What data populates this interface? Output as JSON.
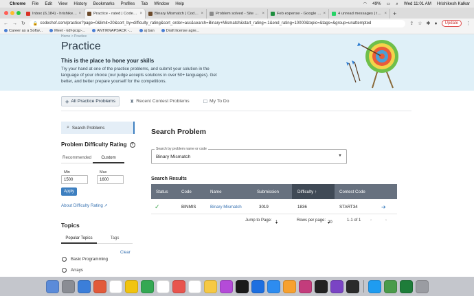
{
  "menubar": {
    "app": "Chrome",
    "items": [
      "File",
      "Edit",
      "View",
      "History",
      "Bookmarks",
      "Profiles",
      "Tab",
      "Window",
      "Help"
    ],
    "battery": "49%",
    "clock": "Wed 11:01 AM",
    "user": "Hrishikesh Kalkar"
  },
  "tabs": [
    {
      "title": "Inbox (6,184) - hrishikesh@co...",
      "color": "#d93025"
    },
    {
      "title": "Practice - rated | CodeChef",
      "color": "#6b4a2b"
    },
    {
      "title": "Binary Mismatch | CodeChef",
      "color": "#6b4a2b"
    },
    {
      "title": "Problem solved - Site Feedbac...",
      "color": "#8a8a8a"
    },
    {
      "title": "Feb expense - Google Sheets",
      "color": "#1e8e3e"
    },
    {
      "title": "4 unread messages | task.to...",
      "color": "#25d366"
    }
  ],
  "toolbar": {
    "url": "codechef.com/practice?page=0&limit=20&sort_by=difficulty_rating&sort_order=asc&search=Binary+Mismatch&start_rating=-1&end_rating=10000&topic=&tags=&group=unattempted",
    "update_label": "Update"
  },
  "bookmarks": [
    "Career as a Softw...",
    "Meet - kdf-pcqz-...",
    "ANTIKNAPSACK -...",
    "aj ban",
    "Draft license agre..."
  ],
  "hero": {
    "breadcrumb": "Home > Practice",
    "title": "Practice",
    "subtitle": "This is the place to hone your skills",
    "description": "Try your hand at one of the practice problems, and submit your solution in the language of your choice (our judge accepts solutions in over 50+ languages). Get better, and better prepare yourself for the competitions."
  },
  "nav": {
    "all": "All Practice Problems",
    "recent": "Recent Contest Problems",
    "todo": "My To Do"
  },
  "sidebar": {
    "search": "Search Problems",
    "rating_title": "Problem Difficulty Rating",
    "recommended": "Recommended",
    "custom": "Custom",
    "min_label": "Min",
    "max_label": "Max",
    "min_value": "1500",
    "max_value": "1600",
    "apply": "Apply",
    "about": "About Difficulty Rating",
    "topics_title": "Topics",
    "popular": "Popular Topics",
    "tags": "Tags",
    "clear": "Clear",
    "topics": [
      "Basic Programming",
      "Arrays"
    ]
  },
  "main": {
    "title": "Search Problem",
    "search_label": "Search by problem name or code",
    "search_value": "Binary Mismatch",
    "results_title": "Search Results",
    "columns": {
      "status": "Status",
      "code": "Code",
      "name": "Name",
      "submission": "Submission",
      "difficulty": "Difficulty",
      "contest": "Contest Code"
    },
    "row": {
      "code": "BINMIS",
      "name": "Binary Mismatch",
      "submission": "3019",
      "difficulty": "1836",
      "contest": "START34"
    },
    "pager": {
      "jump_label": "Jump to Page:",
      "page": "1",
      "rows_label": "Rows per page:",
      "rows": "20",
      "range": "1-1 of 1"
    }
  },
  "dock_apps": [
    "#5b8bd9",
    "#8a8d94",
    "#3b7ed9",
    "#e25a3a",
    "#ffffff",
    "#f1c40f",
    "#34a853",
    "#ffffff",
    "#e8554e",
    "#ffffff",
    "#f6c944",
    "#b44bd8",
    "#1a1a1a",
    "#1d6fe0",
    "#2d8cf0",
    "#f7a12f",
    "#c33c7c",
    "#222222",
    "#7a44c4",
    "#2b2b2b",
    "#1f9cf0",
    "#4a9b4a",
    "#1e7d3a",
    "#9a9ca2"
  ]
}
